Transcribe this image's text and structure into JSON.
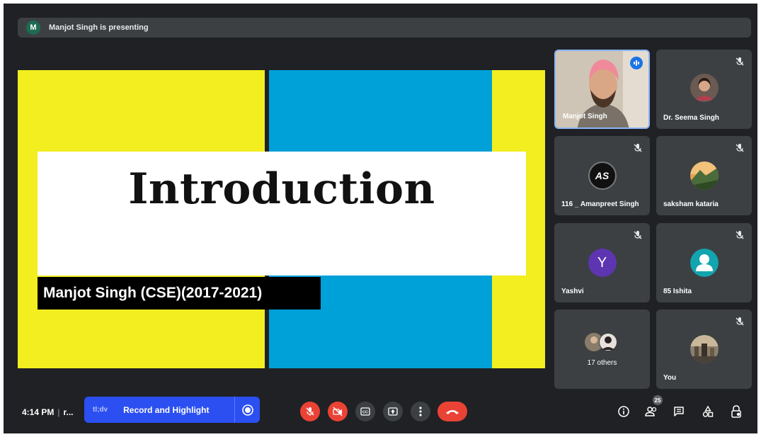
{
  "presentation_banner": {
    "avatar_letter": "M",
    "text": "Manjot Singh is presenting"
  },
  "slide": {
    "title": "Introduction",
    "subtitle": "Manjot Singh (CSE)(2017-2021)",
    "colors": {
      "yellow": "#f2ee1f",
      "blue": "#00a0d8"
    }
  },
  "participants": [
    {
      "name": "Manjot Singh",
      "type": "video",
      "speaking": true,
      "muted": false
    },
    {
      "name": "Dr. Seema Singh",
      "type": "photo",
      "muted": true
    },
    {
      "name": "116 _ Amanpreet Singh",
      "type": "photo",
      "avatar_text": "AS",
      "muted": true
    },
    {
      "name": "saksham kataria",
      "type": "photo",
      "muted": true
    },
    {
      "name": "Yashvi",
      "type": "letter",
      "avatar_text": "Y",
      "avatar_color": "#5e35b1",
      "muted": true
    },
    {
      "name": "85 Ishita",
      "type": "default-avatar",
      "avatar_color": "#12a4af",
      "muted": true
    },
    {
      "name": "17 others",
      "type": "group"
    },
    {
      "name": "You",
      "type": "photo",
      "muted": true
    }
  ],
  "bottom_bar": {
    "time": "4:14 PM",
    "separator": "|",
    "meeting_code": "r...",
    "extension": {
      "logo": "tl;dv",
      "label": "Record and Highlight"
    },
    "participant_count": "25",
    "controls": [
      "mic-off",
      "camera-off",
      "captions",
      "present",
      "more-options",
      "leave-call"
    ],
    "right_icons": [
      "info",
      "people",
      "chat",
      "activities",
      "host-controls"
    ]
  }
}
